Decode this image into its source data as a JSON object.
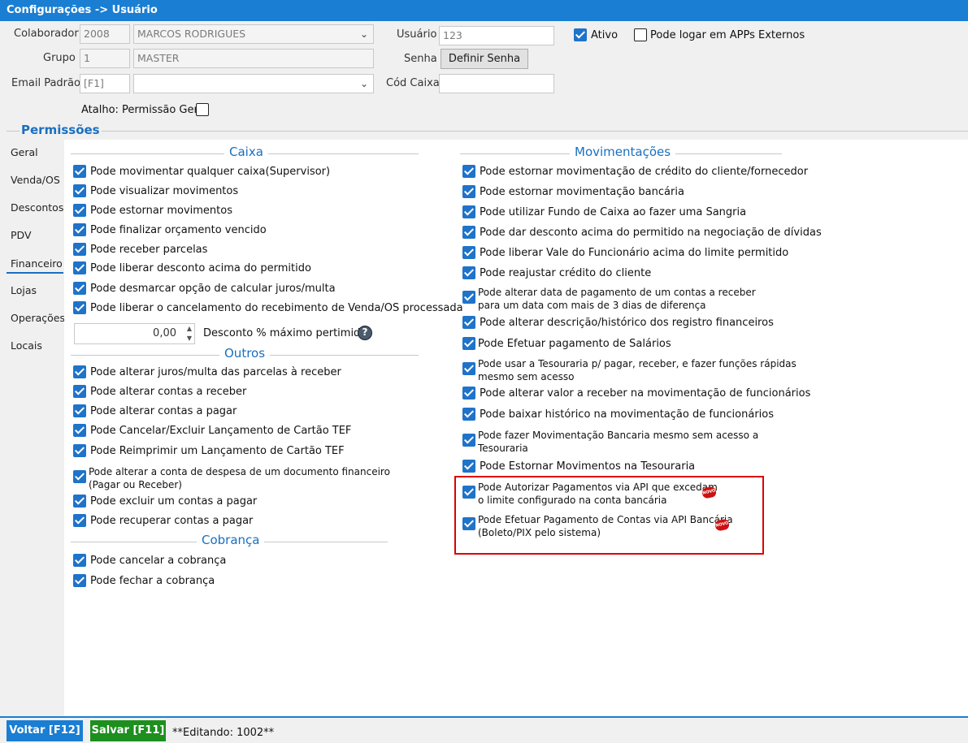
{
  "window": {
    "title": "Configurações -> Usuário"
  },
  "form": {
    "colaborador_label": "Colaborador",
    "colaborador_code": "2008",
    "colaborador_name": "MARCOS RODRIGUES",
    "grupo_label": "Grupo",
    "grupo_code": "1",
    "grupo_name": "MASTER",
    "email_label": "Email Padrão",
    "email_key": "[F1]",
    "email_value": "",
    "usuario_label": "Usuário",
    "usuario_value": "123",
    "senha_label": "Senha",
    "senha_button": "Definir Senha",
    "cod_caixa_label": "Cód Caixa",
    "cod_caixa_value": "",
    "ativo_label": "Ativo",
    "ativo_checked": true,
    "apps_label": "Pode logar em APPs Externos",
    "apps_checked": false,
    "atalho_label": "Atalho: Permissão Geral",
    "atalho_checked": false
  },
  "permissions": {
    "title": "Permissões",
    "tabs": [
      "Geral",
      "Venda/OS",
      "Descontos",
      "PDV",
      "Financeiro",
      "Lojas",
      "Operações",
      "Locais"
    ],
    "active_tab": "Financeiro",
    "caixa": {
      "title": "Caixa",
      "items": [
        "Pode movimentar qualquer caixa(Supervisor)",
        "Pode visualizar movimentos",
        "Pode estornar movimentos",
        "Pode finalizar orçamento vencido",
        "Pode receber parcelas",
        "Pode liberar desconto acima do permitido",
        "Pode desmarcar opção de calcular juros/multa",
        "Pode liberar o cancelamento do recebimento de Venda/OS processada"
      ],
      "desconto_value": "0,00",
      "desconto_label": "Desconto % máximo pertimido"
    },
    "outros": {
      "title": "Outros",
      "items": [
        "Pode alterar juros/multa das parcelas à receber",
        "Pode alterar contas a receber",
        "Pode alterar contas a pagar",
        "Pode Cancelar/Excluir Lançamento de Cartão TEF",
        "Pode Reimprimir um Lançamento de Cartão TEF",
        "Pode alterar a conta de despesa de um documento financeiro",
        "Pode excluir um contas a pagar",
        "Pode recuperar contas a pagar"
      ],
      "item6_line2": "(Pagar ou Receber)"
    },
    "cobranca": {
      "title": "Cobrança",
      "items": [
        "Pode cancelar a cobrança",
        "Pode fechar a cobrança"
      ]
    },
    "movimentacoes": {
      "title": "Movimentações",
      "items": [
        "Pode estornar movimentação de crédito do cliente/fornecedor",
        "Pode estornar movimentação bancária",
        "Pode utilizar Fundo de Caixa ao fazer uma Sangria",
        "Pode dar desconto acima do permitido na negociação de dívidas",
        "Pode liberar Vale do Funcionário acima do limite permitido",
        "Pode reajustar crédito do cliente",
        "Pode alterar data de pagamento de um contas a receber",
        "Pode alterar descrição/histórico dos registro financeiros",
        "Pode Efetuar pagamento de Salários",
        "Pode usar a Tesouraria p/ pagar, receber, e fazer funções rápidas",
        "Pode alterar valor a receber na movimentação de funcionários",
        "Pode baixar histórico na movimentação de funcionários",
        "Pode fazer Movimentação Bancaria mesmo sem acesso a",
        "Pode Estornar Movimentos na Tesouraria",
        "Pode Autorizar Pagamentos via API que excedam",
        "Pode Efetuar Pagamento de Contas via API Bancária"
      ],
      "item7_line2": "para um data com mais de 3 dias de diferença",
      "item10_line2": "mesmo sem acesso",
      "item13_line2": "Tesouraria",
      "item15_line2": "o limite configurado na conta bancária",
      "item16_line2": "(Boleto/PIX pelo sistema)",
      "novo_badge": "NOVO"
    }
  },
  "footer": {
    "voltar": "Voltar [F12]",
    "salvar": "Salvar [F11]",
    "status": "**Editando: 1002**",
    "voltar_color": "#1a7ed3",
    "salvar_color": "#1e8f1e"
  }
}
